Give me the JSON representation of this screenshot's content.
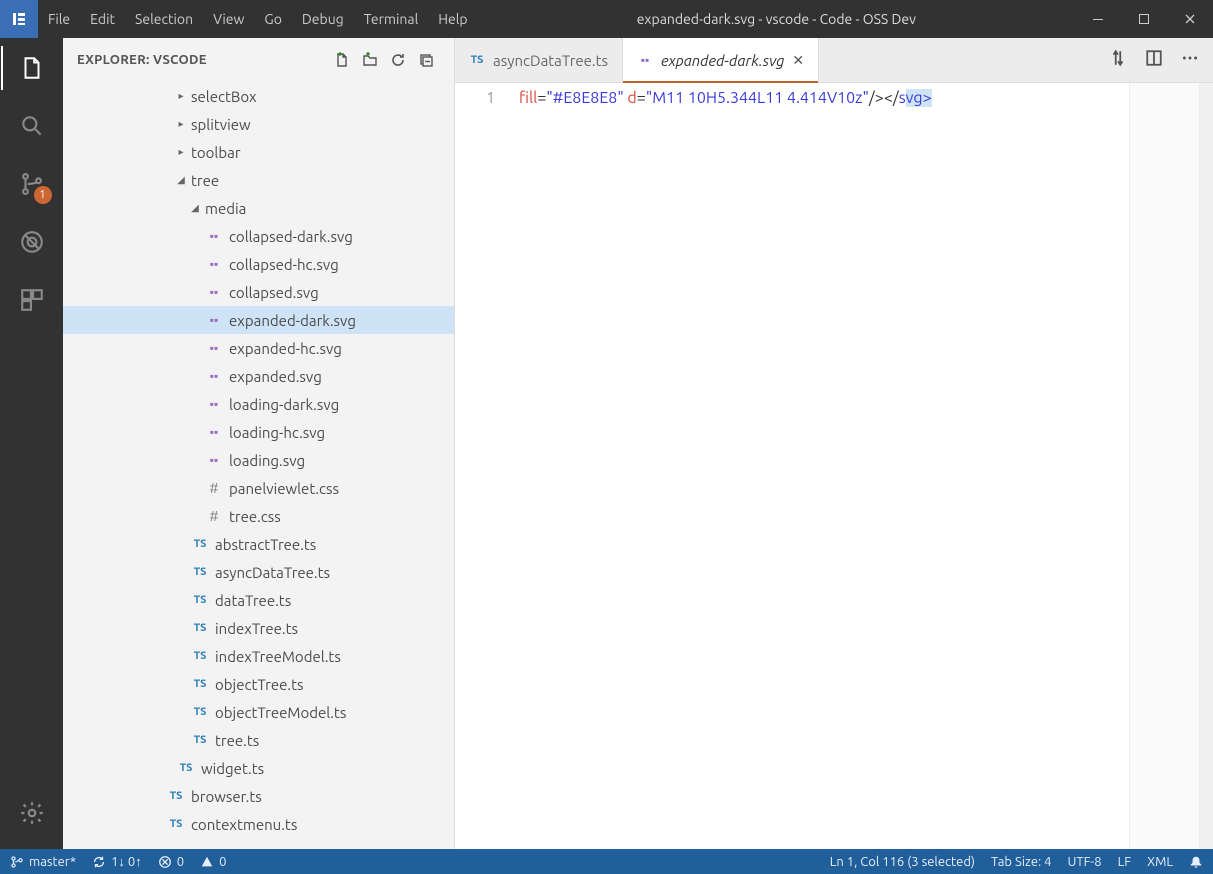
{
  "window": {
    "title": "expanded-dark.svg - vscode - Code - OSS Dev"
  },
  "menubar": [
    "File",
    "Edit",
    "Selection",
    "View",
    "Go",
    "Debug",
    "Terminal",
    "Help"
  ],
  "activitybar": {
    "scm_badge": "1"
  },
  "sidebar": {
    "title": "EXPLORER: VSCODE",
    "tree": [
      {
        "indent": 112,
        "twisty": "right",
        "kind": "folder",
        "label": "selectBox",
        "selected": false
      },
      {
        "indent": 112,
        "twisty": "right",
        "kind": "folder",
        "label": "splitview",
        "selected": false
      },
      {
        "indent": 112,
        "twisty": "right",
        "kind": "folder",
        "label": "toolbar",
        "selected": false
      },
      {
        "indent": 112,
        "twisty": "down",
        "kind": "folder",
        "label": "tree",
        "selected": false
      },
      {
        "indent": 126,
        "twisty": "down",
        "kind": "folder",
        "label": "media",
        "selected": false
      },
      {
        "indent": 126,
        "twisty": "",
        "kind": "svg",
        "label": "collapsed-dark.svg",
        "selected": false
      },
      {
        "indent": 126,
        "twisty": "",
        "kind": "svg",
        "label": "collapsed-hc.svg",
        "selected": false
      },
      {
        "indent": 126,
        "twisty": "",
        "kind": "svg",
        "label": "collapsed.svg",
        "selected": false
      },
      {
        "indent": 126,
        "twisty": "",
        "kind": "svg",
        "label": "expanded-dark.svg",
        "selected": true
      },
      {
        "indent": 126,
        "twisty": "",
        "kind": "svg",
        "label": "expanded-hc.svg",
        "selected": false
      },
      {
        "indent": 126,
        "twisty": "",
        "kind": "svg",
        "label": "expanded.svg",
        "selected": false
      },
      {
        "indent": 126,
        "twisty": "",
        "kind": "svg",
        "label": "loading-dark.svg",
        "selected": false
      },
      {
        "indent": 126,
        "twisty": "",
        "kind": "svg",
        "label": "loading-hc.svg",
        "selected": false
      },
      {
        "indent": 126,
        "twisty": "",
        "kind": "svg",
        "label": "loading.svg",
        "selected": false
      },
      {
        "indent": 126,
        "twisty": "",
        "kind": "css",
        "label": "panelviewlet.css",
        "selected": false
      },
      {
        "indent": 126,
        "twisty": "",
        "kind": "css",
        "label": "tree.css",
        "selected": false
      },
      {
        "indent": 112,
        "twisty": "",
        "kind": "ts",
        "label": "abstractTree.ts",
        "selected": false
      },
      {
        "indent": 112,
        "twisty": "",
        "kind": "ts",
        "label": "asyncDataTree.ts",
        "selected": false
      },
      {
        "indent": 112,
        "twisty": "",
        "kind": "ts",
        "label": "dataTree.ts",
        "selected": false
      },
      {
        "indent": 112,
        "twisty": "",
        "kind": "ts",
        "label": "indexTree.ts",
        "selected": false
      },
      {
        "indent": 112,
        "twisty": "",
        "kind": "ts",
        "label": "indexTreeModel.ts",
        "selected": false
      },
      {
        "indent": 112,
        "twisty": "",
        "kind": "ts",
        "label": "objectTree.ts",
        "selected": false
      },
      {
        "indent": 112,
        "twisty": "",
        "kind": "ts",
        "label": "objectTreeModel.ts",
        "selected": false
      },
      {
        "indent": 112,
        "twisty": "",
        "kind": "ts",
        "label": "tree.ts",
        "selected": false
      },
      {
        "indent": 98,
        "twisty": "",
        "kind": "ts",
        "label": "widget.ts",
        "selected": false
      },
      {
        "indent": 88,
        "twisty": "",
        "kind": "ts",
        "label": "browser.ts",
        "selected": false
      },
      {
        "indent": 88,
        "twisty": "",
        "kind": "ts",
        "label": "contextmenu.ts",
        "selected": false
      }
    ]
  },
  "tabs": [
    {
      "kind": "ts",
      "label": "asyncDataTree.ts",
      "active": false,
      "italic": false,
      "closable": false
    },
    {
      "kind": "svg",
      "label": "expanded-dark.svg",
      "active": true,
      "italic": true,
      "closable": true
    }
  ],
  "editor": {
    "line_number": "1",
    "tokens": {
      "fill_attr": "fill",
      "fill_val": "\"#E8E8E8\"",
      "d_attr": "d",
      "d_val": "\"M11 10H5.344L11 4.414V10z\"",
      "selfclose": "/></",
      "svg_tag": "svg",
      "close": ">"
    }
  },
  "statusbar": {
    "branch": "master*",
    "sync": "1↓ 0↑",
    "errors": "0",
    "warnings": "0",
    "cursor": "Ln 1, Col 116 (3 selected)",
    "indent": "Tab Size: 4",
    "encoding": "UTF-8",
    "eol": "LF",
    "lang": "XML"
  }
}
